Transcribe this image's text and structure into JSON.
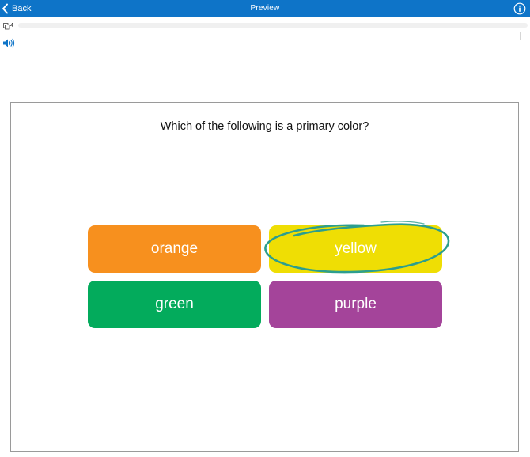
{
  "topbar": {
    "back_label": "Back",
    "title": "Preview"
  },
  "progress": {
    "count": "4",
    "fraction": 0
  },
  "question": {
    "text": "Which of the following is a primary color?"
  },
  "answers": [
    {
      "label": "orange",
      "color": "#f7901e"
    },
    {
      "label": "yellow",
      "color": "#efde04"
    },
    {
      "label": "green",
      "color": "#03ab5c"
    },
    {
      "label": "purple",
      "color": "#a4449a"
    }
  ],
  "colors": {
    "topbar": "#0e74c8",
    "highlight_stroke": "#2c9e8e"
  },
  "icons": {
    "back": "chevron-left-icon",
    "info": "info-circle-icon",
    "count": "copy-stack-icon",
    "audio": "speaker-icon"
  }
}
